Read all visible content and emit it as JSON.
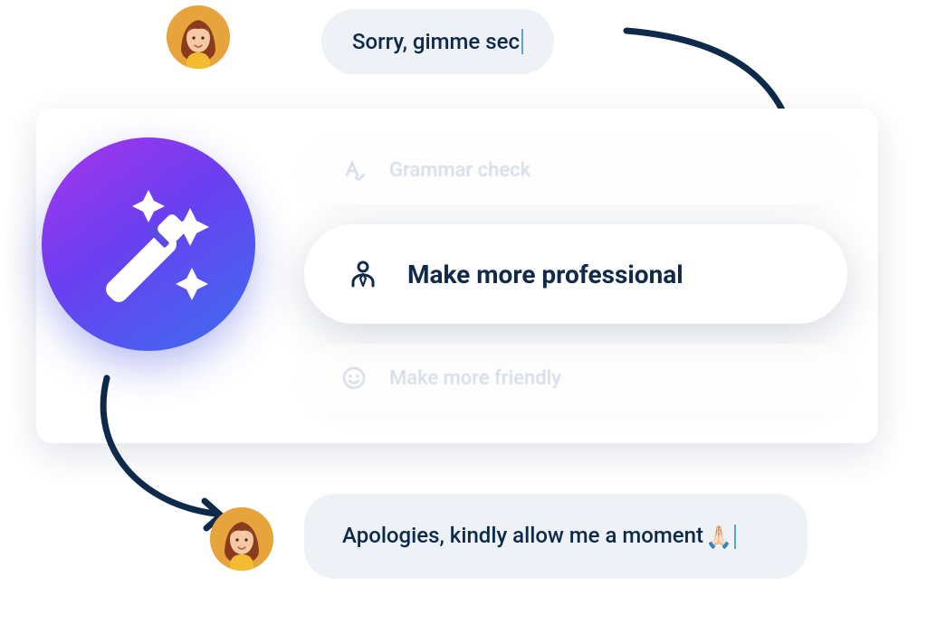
{
  "input_message": "Sorry, gimme sec",
  "options": {
    "grammar": {
      "label": "Grammar check"
    },
    "professional": {
      "label": "Make more professional"
    },
    "friendly": {
      "label": "Make more friendly"
    }
  },
  "output_message_prefix": "Apologies, kindly allow me a moment",
  "output_emoji": "🙏🏻",
  "colors": {
    "bubble_bg": "#eef1f6",
    "text": "#0d2a4a",
    "faded": "#b7c2d4"
  }
}
